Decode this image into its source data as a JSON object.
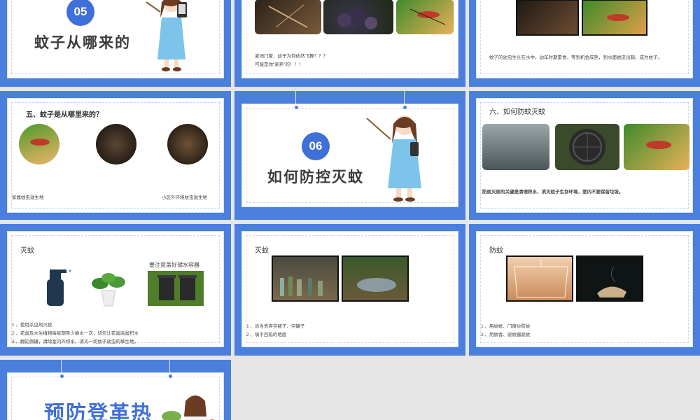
{
  "slides": {
    "s05": {
      "number": "05",
      "title": "蚊子从哪来的"
    },
    "s_closed": {
      "line1": "紧闭门窗，蚊子为何依然飞舞？？？",
      "line2": "可能是你“家养”的！！！"
    },
    "s_larva": {
      "text": "蚊子的幼虫生长在水中，幼年时期素食，等到机会成熟，到水面蜕皮出鞘，成为蚊子。"
    },
    "s_where": {
      "heading": "五、蚊子是从哪里来的？",
      "label_left": "家属蚊虫滋生地",
      "label_right": "小区外环境蚊虫滋生地"
    },
    "s06": {
      "number": "06",
      "title": "如何防控灭蚊"
    },
    "s_prevent": {
      "heading": "六、如何防蚊灭蚊",
      "text": "防蚊灭蚊的关键是清理积水，消灭蚊子生存环境，室内不要保留垃圾。"
    },
    "s_kill1": {
      "heading": "灭蚊",
      "bin_caption": "要注意盖好储水容器",
      "line1": "1 、使用杀虫剂灭蚊",
      "line2": "2 、花盆及水生植物每星期至少换水一次，切勿让花盆底盆积水",
      "line3": "3 、翻缸倒罐，清除室内外积水，消灭一切蚊子幼虫的孳生地。"
    },
    "s_kill2": {
      "heading": "灭蚊",
      "line1": "1 、适当丢弃空瓶子、空罐子",
      "line2": "2 、填平凹陷的地面"
    },
    "s_protect": {
      "heading": "防蚊",
      "line1": "1 、用蚊帐、门窗纱防蚊",
      "line2": "2 、用蚊香、驱蚊器驱蚊"
    },
    "s_last": {
      "title": "预防登革热"
    }
  },
  "colors": {
    "blue": "#4a7fdd",
    "badge": "#3f6fd8",
    "background": "#e6e6e6"
  }
}
